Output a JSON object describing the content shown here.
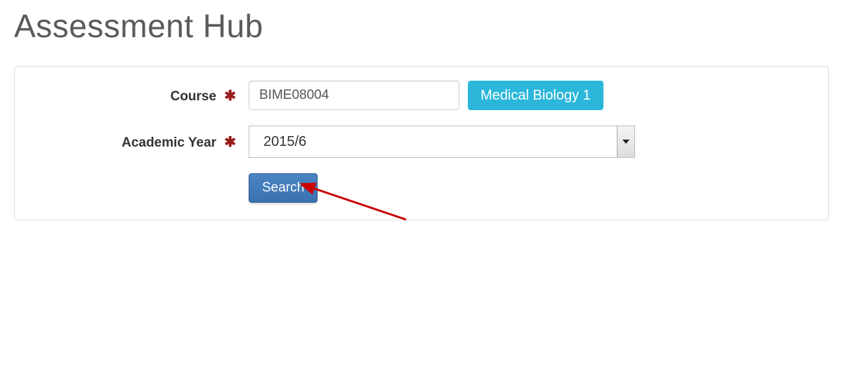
{
  "page": {
    "title": "Assessment Hub"
  },
  "form": {
    "course": {
      "label": "Course",
      "value": "BIME08004",
      "resolved_name": "Medical Biology 1"
    },
    "academic_year": {
      "label": "Academic Year",
      "selected": "2015/6"
    },
    "search_label": "Search",
    "required_glyph": "✱"
  }
}
